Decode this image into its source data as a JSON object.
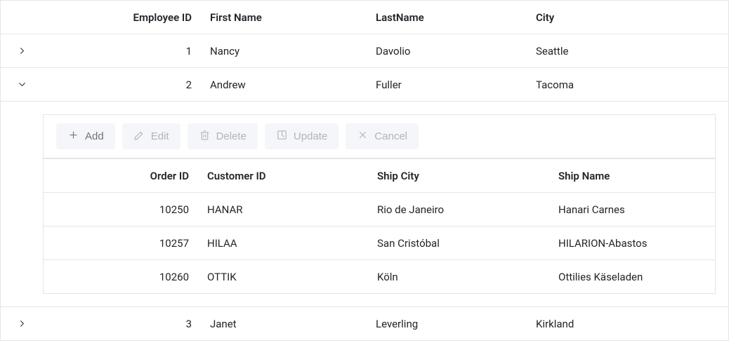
{
  "master": {
    "columns": {
      "empid": "Employee ID",
      "fname": "First Name",
      "lname": "LastName",
      "city": "City"
    },
    "rows": [
      {
        "expanded": false,
        "empid": "1",
        "fname": "Nancy",
        "lname": "Davolio",
        "city": "Seattle"
      },
      {
        "expanded": true,
        "empid": "2",
        "fname": "Andrew",
        "lname": "Fuller",
        "city": "Tacoma"
      },
      {
        "expanded": false,
        "empid": "3",
        "fname": "Janet",
        "lname": "Leverling",
        "city": "Kirkland"
      }
    ]
  },
  "detail": {
    "toolbar": {
      "add": "Add",
      "edit": "Edit",
      "delete": "Delete",
      "update": "Update",
      "cancel": "Cancel"
    },
    "columns": {
      "oid": "Order ID",
      "custid": "Customer ID",
      "shipcity": "Ship City",
      "shipname": "Ship Name"
    },
    "rows": [
      {
        "oid": "10250",
        "custid": "HANAR",
        "shipcity": "Rio de Janeiro",
        "shipname": "Hanari Carnes"
      },
      {
        "oid": "10257",
        "custid": "HILAA",
        "shipcity": "San Cristóbal",
        "shipname": "HILARION-Abastos"
      },
      {
        "oid": "10260",
        "custid": "OTTIK",
        "shipcity": "Köln",
        "shipname": "Ottilies Käseladen"
      }
    ]
  }
}
